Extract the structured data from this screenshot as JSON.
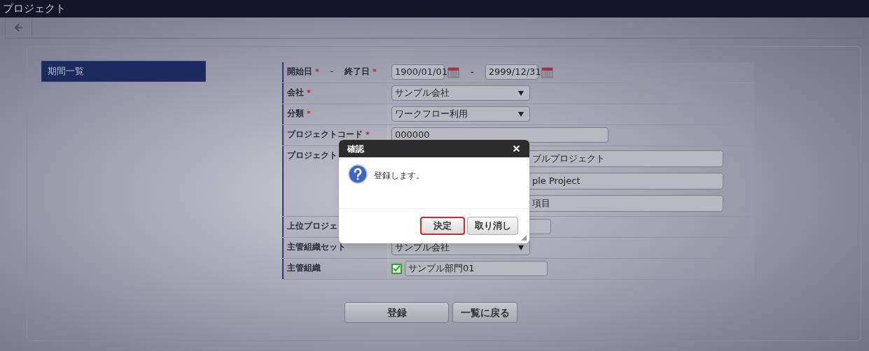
{
  "window": {
    "title": "プロジェクト"
  },
  "sidebar": {
    "items": [
      {
        "label": "期間一覧",
        "selected": true
      }
    ]
  },
  "form": {
    "rows": [
      {
        "kind": "date_range",
        "label": "開始日",
        "required_mark": "*",
        "label_separator": "-",
        "label2": "終了日",
        "required_mark2": "*",
        "separator": "-",
        "start": "1900/01/01",
        "end": "2999/12/31"
      },
      {
        "kind": "select",
        "label": "会社",
        "required_mark": "*",
        "value": "サンプル会社"
      },
      {
        "kind": "select",
        "label": "分類",
        "required_mark": "*",
        "value": "ワークフロー利用"
      },
      {
        "kind": "text",
        "label": "プロジェクトコード",
        "required_mark": "*",
        "value": "000000"
      },
      {
        "kind": "multi_text",
        "label": "プロジェクト",
        "values": [
          "ブルプロジェクト",
          "ple Project",
          "項目"
        ]
      },
      {
        "kind": "text_short",
        "label": "上位プロジェ"
      },
      {
        "kind": "select",
        "label": "主管組織セット",
        "value": "サンプル会社"
      },
      {
        "kind": "checkbox_text",
        "label": "主管組織",
        "value": "サンプル部門01",
        "checked": true
      }
    ]
  },
  "buttons": [
    {
      "label": "登録",
      "kind": "primary"
    },
    {
      "label": "一覧に戻る",
      "kind": "secondary"
    }
  ],
  "dialog": {
    "title": "確認",
    "message": "登録します。",
    "buttons": [
      {
        "label": "決定",
        "focused": true
      },
      {
        "label": "取り消し",
        "focused": false
      }
    ]
  }
}
